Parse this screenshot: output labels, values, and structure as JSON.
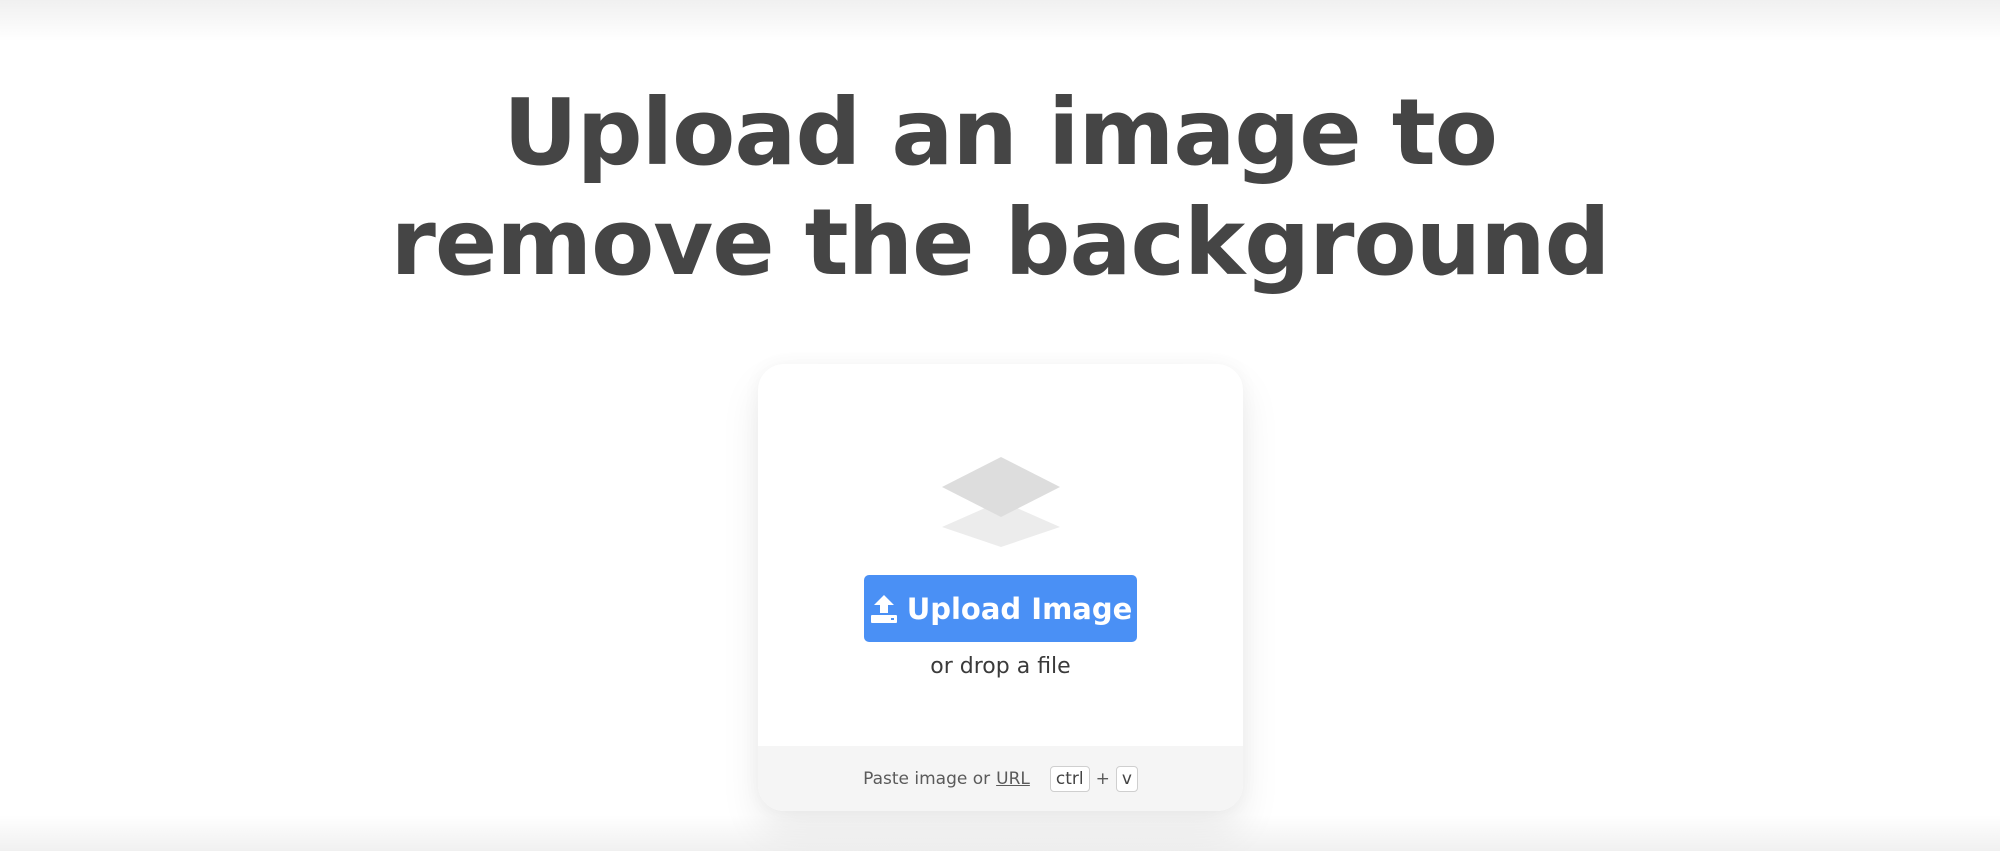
{
  "headline": {
    "line1": "Upload an image to",
    "line2": "remove the background"
  },
  "card": {
    "upload_button_label": "Upload Image",
    "drop_text": "or drop a file",
    "footer": {
      "paste_text": "Paste image or",
      "url_label": "URL",
      "shortcut": {
        "key1": "ctrl",
        "plus": "+",
        "key2": "v"
      }
    },
    "icons": {
      "layers": "layers-icon",
      "upload": "upload-icon"
    }
  },
  "colors": {
    "accent": "#4a90f5",
    "headline": "#454545",
    "footer_bg": "#f5f5f5"
  }
}
